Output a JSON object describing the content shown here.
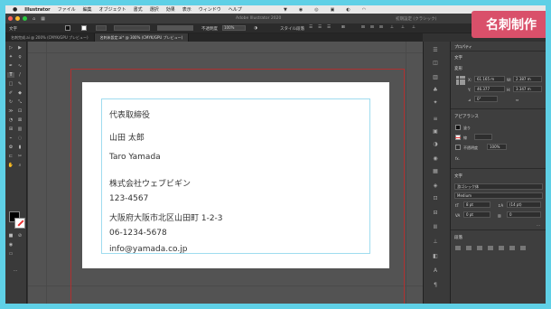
{
  "menubar": {
    "apple": "",
    "app": "Illustrator",
    "items": [
      "ファイル",
      "編集",
      "オブジェクト",
      "書式",
      "選択",
      "効果",
      "表示",
      "ウィンドウ",
      "ヘルプ"
    ]
  },
  "titlebar": {
    "title": "Adobe Illustrator 2020",
    "workspace": "初期設定 (クラシック)"
  },
  "badge": {
    "label": "名刺制作"
  },
  "controlbar": {
    "selection_label": "文字",
    "opacity_label": "不透明度",
    "opacity_value": "100%",
    "style_label": "スタイル",
    "paragraph_label": "段落"
  },
  "tabs": [
    {
      "label": "名刺完成.ai @ 200% (CMYK/GPU プレビュー)"
    },
    {
      "label": "名刺未設定.ai* @ 300% (CMYK/GPU プレビュー)"
    }
  ],
  "card": {
    "role": "代表取締役",
    "name": "山田 太郎",
    "name_roman": "Taro Yamada",
    "company": "株式会社ウェブビギン",
    "postal": "123-4567",
    "address": "大阪府大阪市北区山田町 1-2-3",
    "phone": "06-1234-5678",
    "email": "info@yamada.co.jp"
  },
  "properties_panel": {
    "tab": "プロパティ",
    "type_label": "文字",
    "transform_label": "変形",
    "x_label": "X:",
    "x_value": "61.165 m",
    "w_label": "W:",
    "w_value": "2.387 m",
    "y_label": "Y:",
    "y_value": "46.377",
    "h_label": "H:",
    "h_value": "3.347 m",
    "angle_value": "0°",
    "appearance_label": "アピアランス",
    "fill_label": "塗り",
    "stroke_label": "線",
    "opacity_label": "不透明度",
    "opacity_value": "100%",
    "fx_label": "fx.",
    "character_label": "文字",
    "font_family": "游ゴシック体",
    "font_weight": "Medium",
    "font_size": "8 pt",
    "leading": "(14 pt)",
    "tracking": "0 pt",
    "kerning": "0",
    "paragraph_label": "段落"
  }
}
